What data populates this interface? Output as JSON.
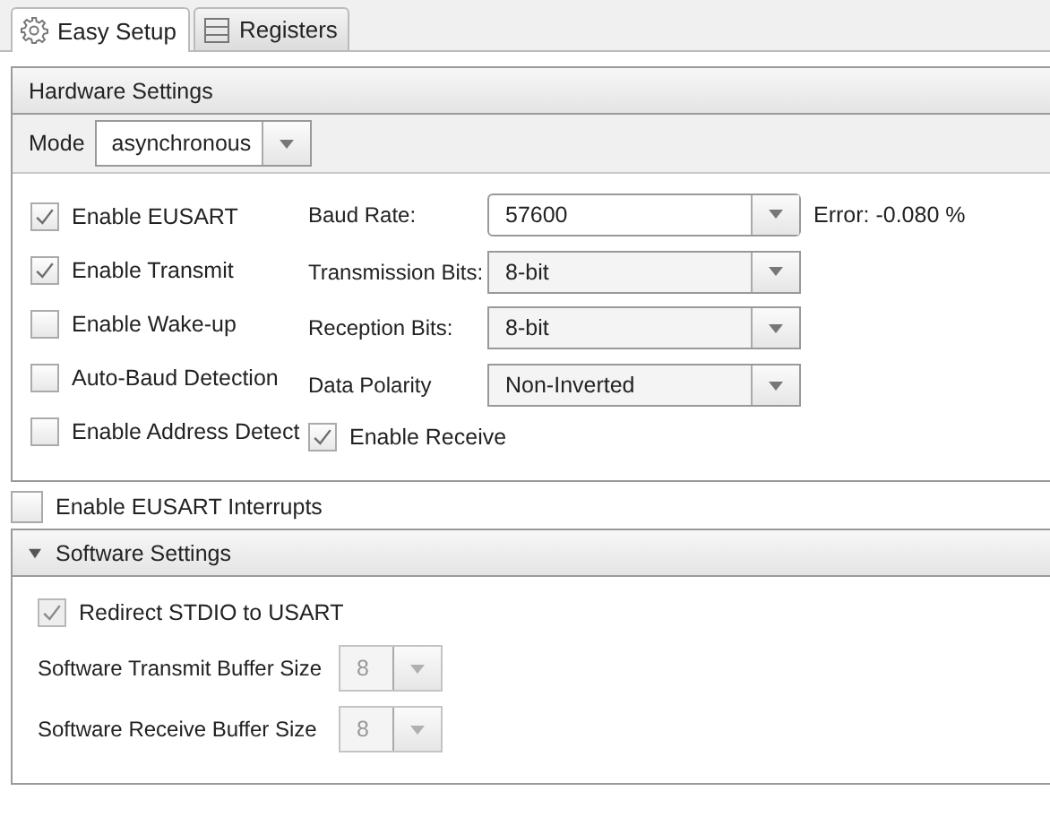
{
  "tabs": [
    {
      "label": "Easy Setup",
      "selected": true
    },
    {
      "label": "Registers",
      "selected": false
    }
  ],
  "hardware": {
    "title": "Hardware Settings",
    "mode": {
      "label": "Mode",
      "value": "asynchronous"
    },
    "checkboxes": [
      {
        "label": "Enable EUSART",
        "checked": true
      },
      {
        "label": "Enable Transmit",
        "checked": true
      },
      {
        "label": "Enable Wake-up",
        "checked": false
      },
      {
        "label": "Auto-Baud Detection",
        "checked": false
      },
      {
        "label": "Enable Address Detect",
        "checked": false
      }
    ],
    "fields": [
      {
        "label": "Baud Rate:",
        "value": "57600",
        "note": "Error: -0.080 %"
      },
      {
        "label": "Transmission Bits:",
        "value": "8-bit"
      },
      {
        "label": "Reception Bits:",
        "value": "8-bit"
      },
      {
        "label": "Data Polarity",
        "value": "Non-Inverted"
      }
    ],
    "enable_receive": {
      "label": "Enable Receive",
      "checked": true
    }
  },
  "interrupts": {
    "label": "Enable EUSART Interrupts",
    "checked": false
  },
  "software": {
    "title": "Software Settings",
    "expanded": true,
    "redirect": {
      "label": "Redirect STDIO to USART",
      "checked": true,
      "disabled": true
    },
    "buffers": [
      {
        "label": "Software Transmit Buffer Size",
        "value": "8",
        "disabled": true
      },
      {
        "label": "Software Receive Buffer Size",
        "value": "8",
        "disabled": true
      }
    ]
  }
}
